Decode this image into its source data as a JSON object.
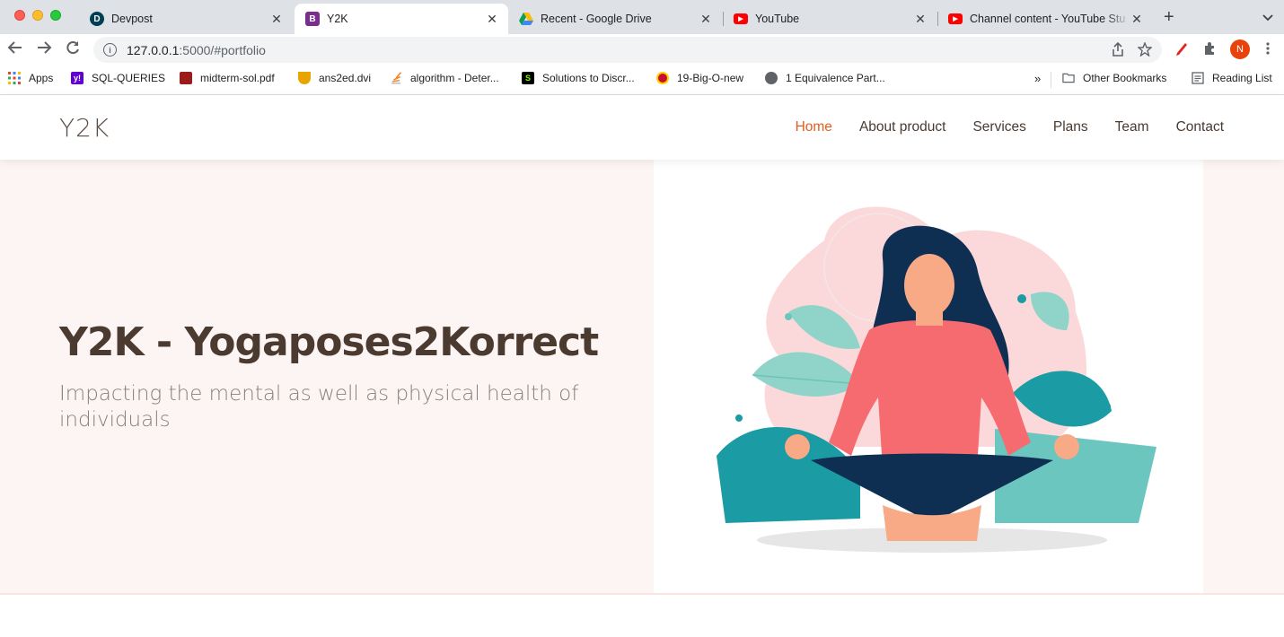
{
  "browser": {
    "tabs": [
      {
        "title": "Devpost",
        "favicon_letter": "D",
        "favicon_color": "#003e54"
      },
      {
        "title": "Y2K",
        "favicon_letter": "B",
        "favicon_color": "#7b2d8e"
      },
      {
        "title": "Recent - Google Drive",
        "favicon_letter": "",
        "favicon_color": "#34a853"
      },
      {
        "title": "YouTube",
        "favicon_letter": "▶",
        "favicon_color": "#ff0000"
      },
      {
        "title": "Channel content - YouTube Stu",
        "favicon_letter": "▶",
        "favicon_color": "#ff0000"
      }
    ],
    "close_glyph": "✕",
    "new_tab_glyph": "+",
    "url_host": "127.0.0.1",
    "url_rest": ":5000/#portfolio",
    "avatar_letter": "N",
    "bookmarks": [
      {
        "label": "Apps",
        "icon_color": "#4285f4"
      },
      {
        "label": "SQL-QUERIES",
        "icon_color": "#6001d2"
      },
      {
        "label": "midterm-sol.pdf",
        "icon_color": "#9b1b1b"
      },
      {
        "label": "ans2ed.dvi",
        "icon_color": "#e8a400"
      },
      {
        "label": "algorithm - Deter...",
        "icon_color": "#f48024"
      },
      {
        "label": "Solutions to Discr...",
        "icon_color": "#000000"
      },
      {
        "label": "19-Big-O-new",
        "icon_color": "#c8102e"
      },
      {
        "label": "1 Equivalence Part...",
        "icon_color": "#5f6368"
      }
    ],
    "bookmarks_overflow": "»",
    "other_bookmarks": "Other Bookmarks",
    "reading_list": "Reading List"
  },
  "site": {
    "logo": "Y2K",
    "nav": [
      "Home",
      "About product",
      "Services",
      "Plans",
      "Team",
      "Contact"
    ],
    "hero_title": "Y2K - Yogaposes2Korrect",
    "hero_subtitle": "Impacting the mental as well as physical health of individuals"
  },
  "colors": {
    "accent": "#e35d1d",
    "hero_bg": "#fdf5f3",
    "text_dark": "#4a3a30"
  }
}
